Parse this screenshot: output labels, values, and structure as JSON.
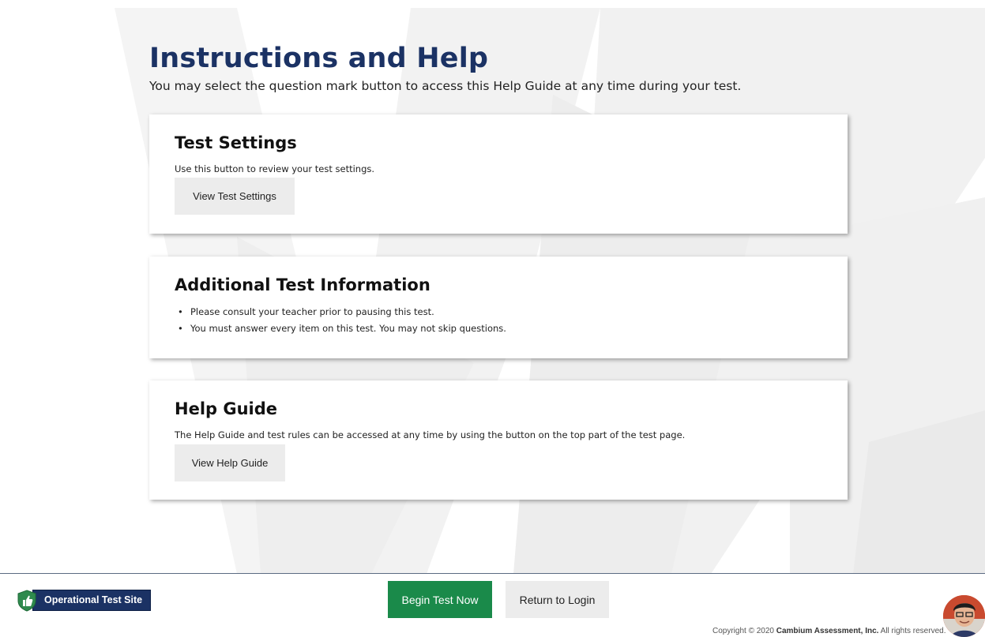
{
  "header": {
    "title": "Instructions and Help",
    "subtitle": "You may select the question mark button to access this Help Guide at any time during your test."
  },
  "test_settings": {
    "heading": "Test Settings",
    "description": "Use this button to review your test settings.",
    "button_label": "View Test Settings"
  },
  "additional_info": {
    "heading": "Additional Test Information",
    "items": [
      "Please consult your teacher prior to pausing this test.",
      "You must answer every item on this test. You may not skip questions."
    ]
  },
  "help_guide": {
    "heading": "Help Guide",
    "description": "The Help Guide and test rules can be accessed at any time by using the button on the top part of the test page.",
    "button_label": "View Help Guide"
  },
  "footer": {
    "site_label": "Operational Test Site",
    "begin_button": "Begin Test Now",
    "return_button": "Return to Login",
    "copyright_prefix": "Copyright © 2020 ",
    "copyright_company": "Cambium Assessment, Inc.",
    "copyright_suffix": " All rights reserved."
  },
  "colors": {
    "title": "#1b3264",
    "begin_button": "#1a8a4a",
    "site_badge": "#1b3264",
    "gray_button": "#ececec"
  },
  "icons": {
    "site_badge": "shield-thumbs-up-icon",
    "user": "avatar"
  }
}
